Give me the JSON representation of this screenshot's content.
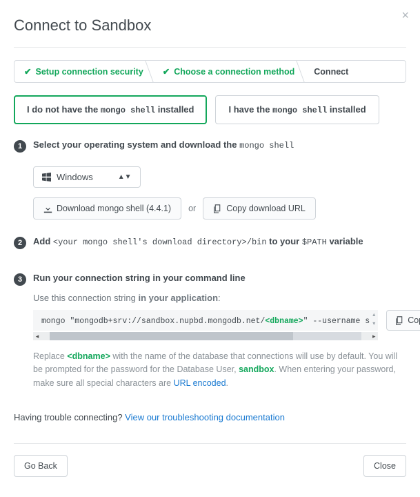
{
  "title": "Connect to Sandbox",
  "steps": {
    "s1": "Setup connection security",
    "s2": "Choose a connection method",
    "s3": "Connect"
  },
  "tabs": {
    "no_shell_pre": "I do not have the ",
    "no_shell_mono": "mongo shell",
    "no_shell_post": " installed",
    "have_shell_pre": "I have the ",
    "have_shell_mono": "mongo shell",
    "have_shell_post": " installed"
  },
  "step1": {
    "text_pre": "Select your operating system and download the ",
    "text_mono": "mongo shell",
    "os_selected": "Windows",
    "download_label": "Download mongo shell (4.4.1)",
    "or": "or",
    "copy_url_label": "Copy download URL"
  },
  "step2": {
    "pre": "Add ",
    "mono": "<your mongo shell's download directory>/bin",
    "mid": " to your ",
    "mono2": "$PATH",
    "post": " variable"
  },
  "step3": {
    "title": "Run your connection string in your command line",
    "subtext_pre": "Use this connection string ",
    "subtext_bold": "in your application",
    "subtext_post": ":",
    "code_pre": "mongo \"mongodb+srv://sandbox.nupbd.mongodb.net/",
    "code_db": "<dbname>",
    "code_post": "\" --username s",
    "copy": "Copy",
    "note_1": "Replace ",
    "note_db": "<dbname>",
    "note_2": " with the name of the database that connections will use by default. You will be prompted for the password for the Database User, ",
    "note_user": "sandbox",
    "note_3": ". When entering your password, make sure all special characters are ",
    "note_link": "URL encoded",
    "note_4": "."
  },
  "trouble": {
    "pre": "Having trouble connecting? ",
    "link": "View our troubleshooting documentation"
  },
  "footer": {
    "back": "Go Back",
    "close": "Close"
  }
}
